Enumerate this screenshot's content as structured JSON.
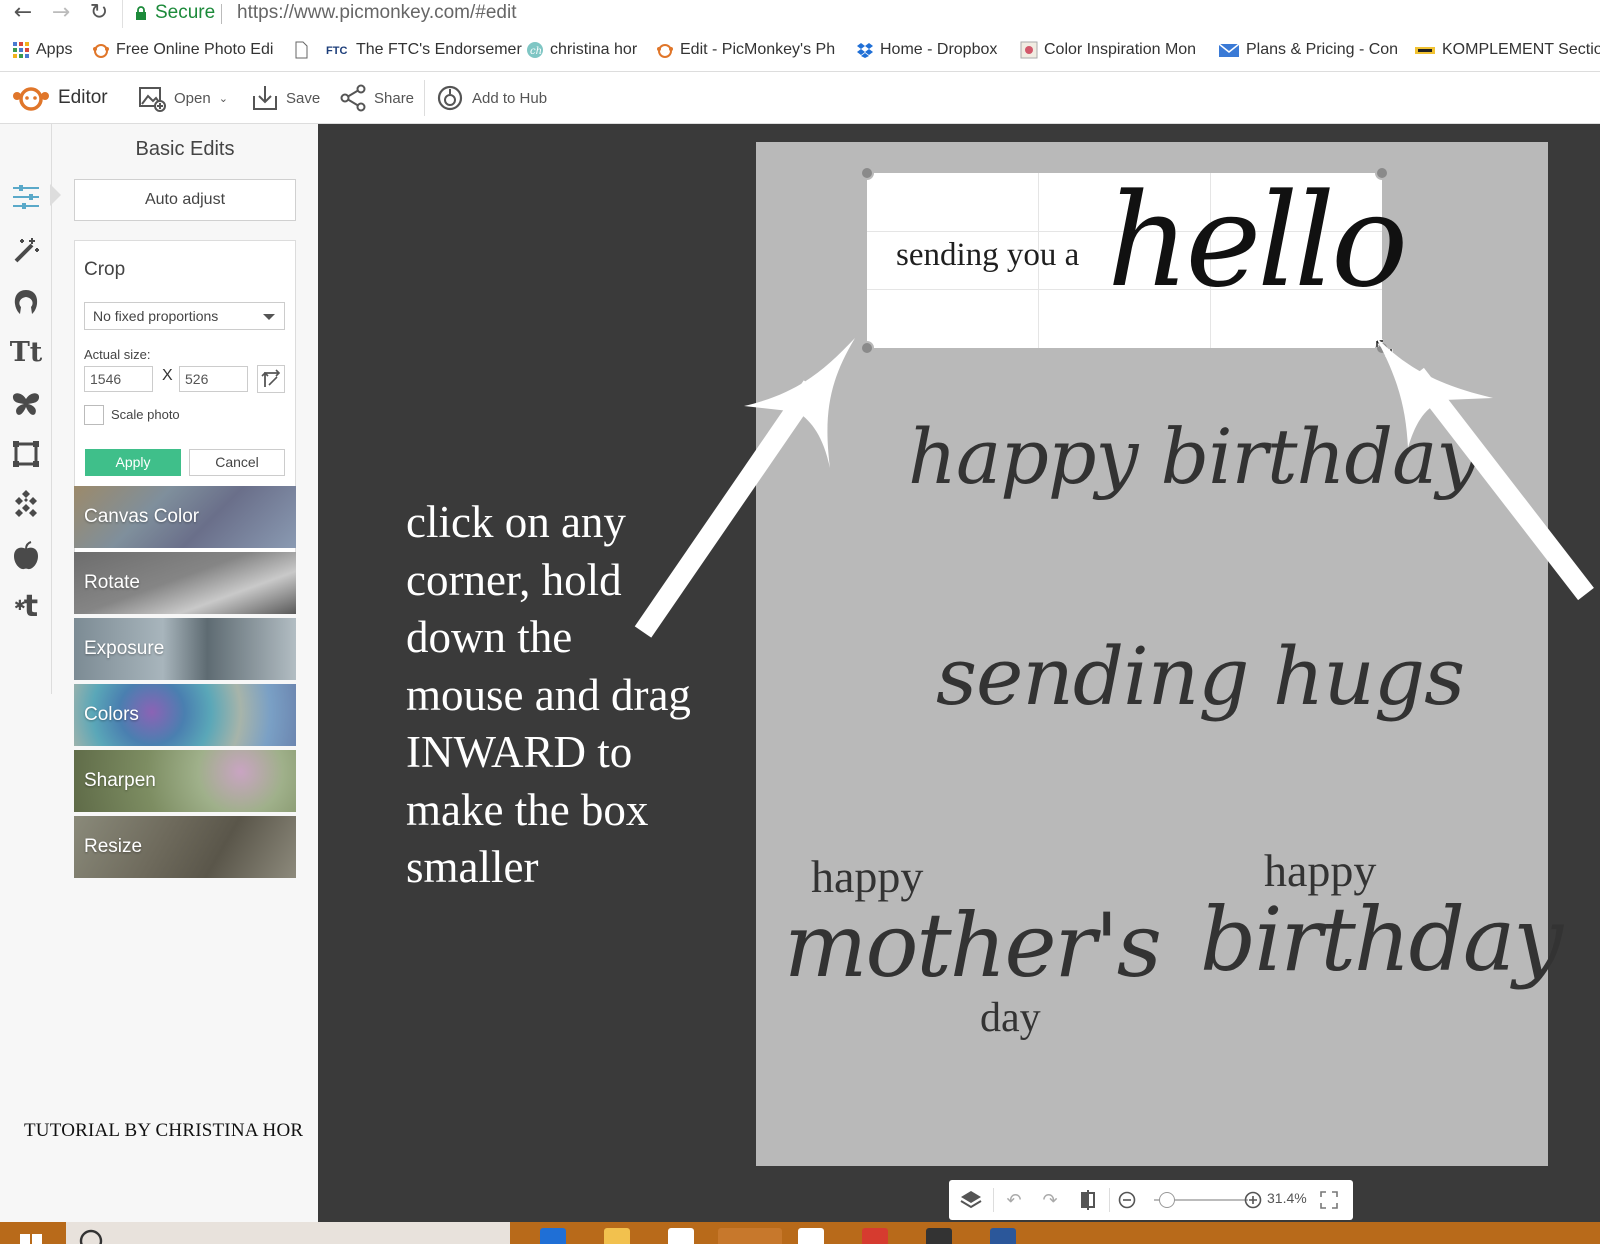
{
  "browser": {
    "secure_label": "Secure",
    "url": "https://www.picmonkey.com/#edit",
    "bookmarks": [
      {
        "label": "Apps",
        "icon": "apps-grid-icon"
      },
      {
        "label": "Free Online Photo Edi",
        "icon": "picmonkey-icon"
      },
      {
        "label": "",
        "icon": "page-icon"
      },
      {
        "label": "The FTC's Endorsemer",
        "icon": "ftc-icon"
      },
      {
        "label": "christina hor",
        "icon": "christina-hor-icon"
      },
      {
        "label": "Edit - PicMonkey's Ph",
        "icon": "picmonkey-icon"
      },
      {
        "label": "Home - Dropbox",
        "icon": "dropbox-icon"
      },
      {
        "label": "Color Inspiration Mon",
        "icon": "color-inspiration-icon"
      },
      {
        "label": "Plans & Pricing - Con",
        "icon": "mail-icon"
      },
      {
        "label": "KOMPLEMENT Sectio",
        "icon": "komplement-icon"
      }
    ]
  },
  "toolbar": {
    "editor_label": "Editor",
    "open_label": "Open",
    "save_label": "Save",
    "share_label": "Share",
    "hub_label": "Add to Hub"
  },
  "panel": {
    "title": "Basic Edits",
    "auto_adjust": "Auto adjust",
    "crop": {
      "title": "Crop",
      "proportions": "No fixed proportions",
      "actual_size_label": "Actual size:",
      "width": "1546",
      "height": "526",
      "x_label": "X",
      "scale_label": "Scale photo",
      "scale_checked": false,
      "apply": "Apply",
      "cancel": "Cancel"
    },
    "tiles": [
      "Canvas Color",
      "Rotate",
      "Exposure",
      "Colors",
      "Sharpen",
      "Resize"
    ],
    "rail_icons": [
      "basic-edits-sliders-icon",
      "magic-wand-icon",
      "touch-up-face-icon",
      "text-tt-icon",
      "butterfly-overlay-icon",
      "frame-icon",
      "texture-icon",
      "apple-theme-icon",
      "theme-t-icon"
    ]
  },
  "credit": "TUTORIAL BY CHRISTINA HOR",
  "canvas": {
    "instruction_lines": [
      "click on any",
      "corner, hold",
      "down the",
      "mouse and drag",
      "INWARD to",
      "make the box",
      "smaller"
    ],
    "hello_small": "sending you a",
    "hello_big": "hello",
    "happy_birthday_script": "happy birthday",
    "sending_hugs": "sending hugs",
    "mothers_happy": "happy",
    "mothers_script": "mother's",
    "mothers_day": "day",
    "birthday_happy": "happy",
    "birthday_script": "birthday"
  },
  "zoom": {
    "value": "31.4%",
    "level_fraction": 0.14
  },
  "colors": {
    "accent_green": "#3fbf8a",
    "secure_green": "#1c8a3a",
    "workspace": "#3a3a3a",
    "artboard": "#b9b9b9",
    "taskbar": "#b86a1a"
  }
}
